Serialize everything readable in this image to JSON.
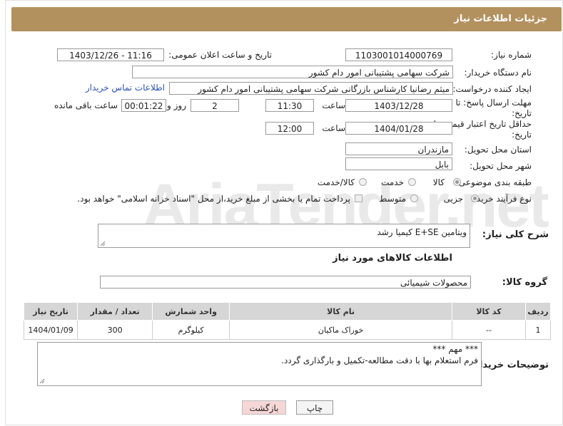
{
  "title": "جزئیات اطلاعات نیاز",
  "fields": {
    "need_number_label": "شماره نیاز:",
    "need_number": "1103001014000769",
    "announce_label": "تاریخ و ساعت اعلان عمومی:",
    "announce_value": "1403/12/26 - 11:16",
    "buyer_org_label": "نام دستگاه خریدار:",
    "buyer_org": "شرکت سهامی پشتیبانی امور دام کشور",
    "creator_label": "ایجاد کننده درخواست:",
    "creator": "میثم رضانیا کارشناس بازرگانی شرکت سهامی پشتیبانی امور دام کشور",
    "contact_link": "اطلاعات تماس خریدار",
    "reply_deadline_label": "مهلت ارسال پاسخ: تا تاریخ:",
    "reply_date": "1403/12/28",
    "time_word": "ساعت",
    "reply_time": "11:30",
    "days": "2",
    "days_word": "روز و",
    "remaining": "00:01:22",
    "remaining_word": "ساعت باقی مانده",
    "price_validity_label": "حداقل تاریخ اعتبار قیمت: تا تاریخ:",
    "price_date": "1404/01/28",
    "price_time": "12:00",
    "province_label": "استان محل تحویل:",
    "province": "مازندران",
    "city_label": "شهر محل تحویل:",
    "city": "بابل",
    "category_label": "طبقه بندی موضوعی:",
    "category_options": [
      "کالا",
      "خدمت",
      "کالا/خدمت"
    ],
    "process_label": "نوع فرآیند خرید :",
    "process_options": [
      "جزیی",
      "متوسط"
    ],
    "payment_note": "پرداخت تمام یا بخشی از مبلغ خرید،از محل \"اسناد خزانه اسلامی\" خواهد بود."
  },
  "description": {
    "label": "شرح کلی نیاز:",
    "value": "ویتامین E+SE  کیمیا رشد"
  },
  "goods": {
    "section_title": "اطلاعات کالاهای مورد نیاز",
    "group_label": "گروه کالا:",
    "group_value": "محصولات شیمیائی",
    "columns": [
      "ردیف",
      "کد کالا",
      "نام کالا",
      "واحد شمارش",
      "تعداد / مقدار",
      "تاریخ نیاز"
    ],
    "rows": [
      [
        "1",
        "--",
        "خوراک ماکیان",
        "کیلوگرم",
        "300",
        "1404/01/09"
      ]
    ]
  },
  "buyer_notes": {
    "label": "توضیحات خریدار:",
    "line1": "*** مهم ***",
    "line2": "فرم استعلام بها با دقت مطالعه-تکمیل و بارگذاری گردد."
  },
  "buttons": {
    "print": "چاپ",
    "back": "بازگشت"
  },
  "watermark": "AriaTender.net",
  "colors": {
    "title_bar": "#b3915f",
    "table_header": "#d6d6d6",
    "link": "#2a53b8",
    "back_button": "#f6d7d7"
  }
}
